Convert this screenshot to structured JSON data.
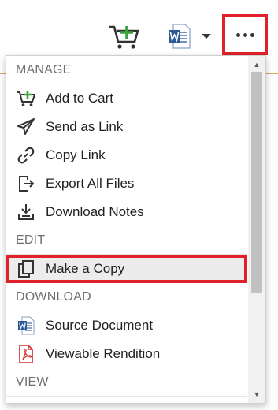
{
  "toolbar": {
    "cart_icon": "add-to-cart-icon",
    "word_icon": "word-document-icon",
    "more_icon": "more-options-icon"
  },
  "menu": {
    "sections": [
      {
        "title": "MANAGE",
        "items": [
          {
            "label": "Add to Cart",
            "icon": "add-to-cart-icon"
          },
          {
            "label": "Send as Link",
            "icon": "send-icon"
          },
          {
            "label": "Copy Link",
            "icon": "link-icon"
          },
          {
            "label": "Export All Files",
            "icon": "export-icon"
          },
          {
            "label": "Download Notes",
            "icon": "download-icon"
          }
        ]
      },
      {
        "title": "EDIT",
        "items": [
          {
            "label": "Make a Copy",
            "icon": "copy-icon",
            "highlighted": true
          }
        ]
      },
      {
        "title": "DOWNLOAD",
        "items": [
          {
            "label": "Source Document",
            "icon": "word-document-icon"
          },
          {
            "label": "Viewable Rendition",
            "icon": "pdf-icon"
          }
        ]
      },
      {
        "title": "VIEW",
        "items": []
      }
    ]
  },
  "colors": {
    "highlight_border": "#e0202a",
    "accent_orange": "#f0a050",
    "cart_green": "#3aa340",
    "word_blue": "#2b5797",
    "pdf_red": "#d42b2b"
  }
}
